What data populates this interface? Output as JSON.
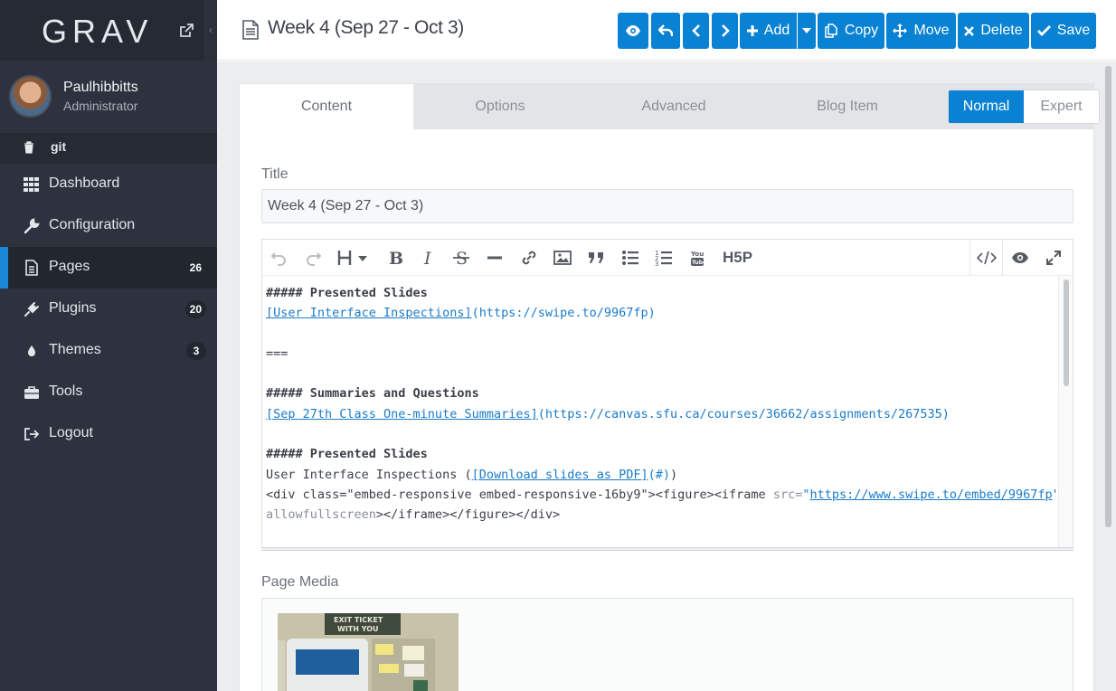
{
  "sidebar": {
    "logo": "GRAV",
    "user": {
      "name": "Paulhibbitts",
      "role": "Administrator"
    },
    "git_label": "git",
    "items": [
      {
        "label": "Dashboard",
        "icon": "grid-icon"
      },
      {
        "label": "Configuration",
        "icon": "wrench-icon"
      },
      {
        "label": "Pages",
        "icon": "file-icon",
        "badge": "26",
        "active": true
      },
      {
        "label": "Plugins",
        "icon": "plug-icon",
        "badge": "20"
      },
      {
        "label": "Themes",
        "icon": "drop-icon",
        "badge": "3"
      },
      {
        "label": "Tools",
        "icon": "briefcase-icon"
      },
      {
        "label": "Logout",
        "icon": "logout-icon"
      }
    ]
  },
  "header": {
    "title": "Week 4 (Sep 27 - Oct 3)",
    "buttons": {
      "add": "Add",
      "copy": "Copy",
      "move": "Move",
      "delete": "Delete",
      "save": "Save"
    }
  },
  "tabs": [
    "Content",
    "Options",
    "Advanced",
    "Blog Item"
  ],
  "mode": {
    "normal": "Normal",
    "expert": "Expert",
    "selected": "Normal"
  },
  "form": {
    "title_label": "Title",
    "title_value": "Week 4 (Sep 27 - Oct 3)",
    "media_label": "Page Media"
  },
  "editor": {
    "h5p_label": "H5P",
    "lines": {
      "l1": "##### Presented Slides",
      "l2_link": "[User Interface Inspections]",
      "l2_url": "(https://swipe.to/9967fp)",
      "l3": "===",
      "l4": "##### Summaries and Questions",
      "l5_link": "[Sep 27th Class One-minute Summaries]",
      "l5_url": "(https://canvas.sfu.ca/courses/36662/assignments/267535)",
      "l6": "##### Presented Slides",
      "l7_a": "User Interface Inspections (",
      "l7_link": "[Download slides as PDF]",
      "l7_b": "(#)",
      "l7_c": ")",
      "l8_a": "<div class=\"embed-responsive embed-responsive-16by9\"><figure><iframe ",
      "l8_attr": "src=",
      "l8_q1": "\"",
      "l8_url": "https://www.swipe.to/embed/9967fp",
      "l8_q2": "\"",
      "l9_attr": "allowfullscreen",
      "l9_b": "></iframe></figure></div>"
    }
  },
  "colors": {
    "accent": "#0a82d3",
    "sidebar_bg": "#2d323e",
    "sidebar_dark": "#262a35",
    "link": "#1a7bc9"
  }
}
